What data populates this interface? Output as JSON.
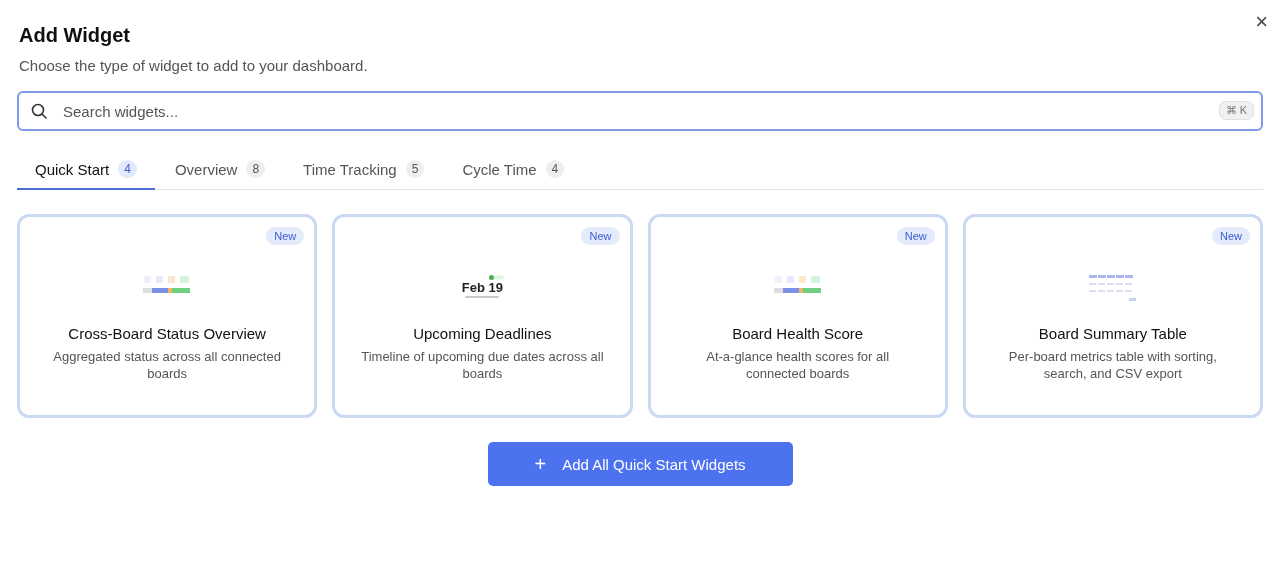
{
  "dialog": {
    "title": "Add Widget",
    "subtitle": "Choose the type of widget to add to your dashboard.",
    "close": "×"
  },
  "search": {
    "placeholder": "Search widgets...",
    "shortcut": "⌘ K"
  },
  "tabs": [
    {
      "label": "Quick Start",
      "count": "4",
      "selected": true
    },
    {
      "label": "Overview",
      "count": "8",
      "selected": false
    },
    {
      "label": "Time Tracking",
      "count": "5",
      "selected": false
    },
    {
      "label": "Cycle Time",
      "count": "4",
      "selected": false
    }
  ],
  "widgets": [
    {
      "kind": "status",
      "badge": "New",
      "title": "Cross-Board Status Overview",
      "description": "Aggregated status across all connected boards"
    },
    {
      "kind": "deadline",
      "badge": "New",
      "preview_text": "Feb 19",
      "title": "Upcoming Deadlines",
      "description": "Timeline of upcoming due dates across all boards"
    },
    {
      "kind": "status",
      "badge": "New",
      "title": "Board Health Score",
      "description": "At-a-glance health scores for all connected boards"
    },
    {
      "kind": "table",
      "badge": "New",
      "title": "Board Summary Table",
      "description": "Per-board metrics table with sorting, search, and CSV export"
    }
  ],
  "add_all_button": {
    "icon": "+",
    "label": "Add All Quick Start Widgets"
  }
}
